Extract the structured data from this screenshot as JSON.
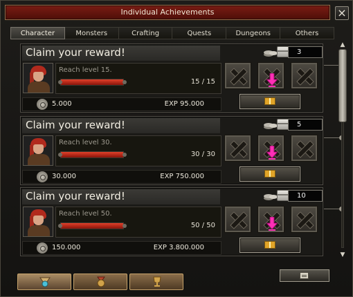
{
  "window": {
    "title": "Individual Achievements"
  },
  "tabs": [
    "Character",
    "Monsters",
    "Crafting",
    "Quests",
    "Dungeons",
    "Others"
  ],
  "active_tab": "Character",
  "achievements": [
    {
      "title": "Claim your reward!",
      "count": "3",
      "description": "Reach level 15.",
      "progress_text": "15 / 15",
      "progress": 1.0,
      "zeny": "5.000",
      "exp": "EXP 95.000"
    },
    {
      "title": "Claim your reward!",
      "count": "5",
      "description": "Reach level 30.",
      "progress_text": "30 / 30",
      "progress": 1.0,
      "zeny": "30.000",
      "exp": "EXP 750.000"
    },
    {
      "title": "Claim your reward!",
      "count": "10",
      "description": "Reach level 50.",
      "progress_text": "50 / 50",
      "progress": 1.0,
      "zeny": "150.000",
      "exp": "EXP 3.800.000"
    }
  ],
  "icons": {
    "close": "close-icon",
    "token": "R",
    "chest": "chest-icon",
    "coin": "coin-icon",
    "gift": "gift-icon",
    "arrow": "pink-arrow-icon",
    "locked_slot": "locked-slot-icon"
  },
  "colors": {
    "title_bar": "#6a160d",
    "progress_fill": "#d63a24",
    "arrow": "#ff2fb6",
    "token": "#2f5fb4"
  },
  "scroll": {
    "position": 0.0
  },
  "bottom_tabs": [
    "achievement-badge-icon",
    "medal-icon",
    "trophy-icon"
  ],
  "active_bottom_tab": 0
}
